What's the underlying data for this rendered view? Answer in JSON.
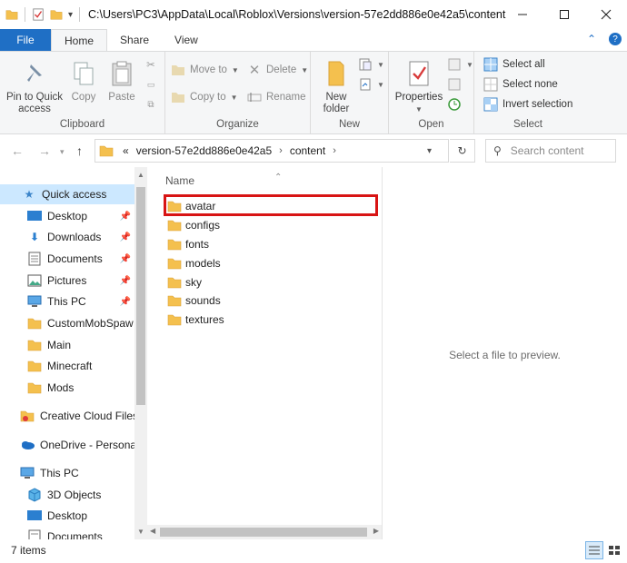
{
  "window": {
    "title": "C:\\Users\\PC3\\AppData\\Local\\Roblox\\Versions\\version-57e2dd886e0e42a5\\content"
  },
  "ribbon_tabs": {
    "file": "File",
    "home": "Home",
    "share": "Share",
    "view": "View"
  },
  "ribbon": {
    "clipboard": {
      "label": "Clipboard",
      "pin_to_quick_access": "Pin to Quick access",
      "copy": "Copy",
      "paste": "Paste"
    },
    "organize": {
      "label": "Organize",
      "move_to": "Move to",
      "copy_to": "Copy to",
      "delete": "Delete",
      "rename": "Rename"
    },
    "new": {
      "label": "New",
      "new_folder": "New folder"
    },
    "open": {
      "label": "Open",
      "properties": "Properties"
    },
    "select": {
      "label": "Select",
      "select_all": "Select all",
      "select_none": "Select none",
      "invert_selection": "Invert selection"
    }
  },
  "address_bar": {
    "overflow": "«",
    "crumbs": [
      "version-57e2dd886e0e42a5",
      "content"
    ]
  },
  "search": {
    "placeholder": "Search content"
  },
  "sidebar": {
    "items": [
      {
        "label": "Quick access",
        "icon": "star-icon",
        "pinned": false
      },
      {
        "label": "Desktop",
        "icon": "desktop-icon",
        "pinned": true
      },
      {
        "label": "Downloads",
        "icon": "download-icon",
        "pinned": true
      },
      {
        "label": "Documents",
        "icon": "documents-icon",
        "pinned": true
      },
      {
        "label": "Pictures",
        "icon": "pictures-icon",
        "pinned": true
      },
      {
        "label": "This PC",
        "icon": "computer-icon",
        "pinned": true
      },
      {
        "label": "CustomMobSpaw",
        "icon": "folder-icon",
        "pinned": false
      },
      {
        "label": "Main",
        "icon": "folder-icon",
        "pinned": false
      },
      {
        "label": "Minecraft",
        "icon": "folder-icon",
        "pinned": false
      },
      {
        "label": "Mods",
        "icon": "folder-icon",
        "pinned": false
      },
      {
        "label": "Creative Cloud Files",
        "icon": "creative-cloud-icon",
        "pinned": false
      },
      {
        "label": "OneDrive - Personal",
        "icon": "onedrive-icon",
        "pinned": false
      },
      {
        "label": "This PC",
        "icon": "computer-icon",
        "pinned": false
      },
      {
        "label": "3D Objects",
        "icon": "cube-icon",
        "pinned": false
      },
      {
        "label": "Desktop",
        "icon": "desktop-icon",
        "pinned": false
      },
      {
        "label": "Documents",
        "icon": "documents-icon",
        "pinned": false
      }
    ]
  },
  "filelist": {
    "column_name": "Name",
    "items": [
      "avatar",
      "configs",
      "fonts",
      "models",
      "sky",
      "sounds",
      "textures"
    ],
    "highlighted": "avatar"
  },
  "preview": {
    "message": "Select a file to preview."
  },
  "status": {
    "count": "7 items"
  },
  "colors": {
    "accent": "#1f6fc5",
    "selection": "#cce8ff",
    "highlight_border": "#d81414",
    "folder": "#f4c04e"
  }
}
